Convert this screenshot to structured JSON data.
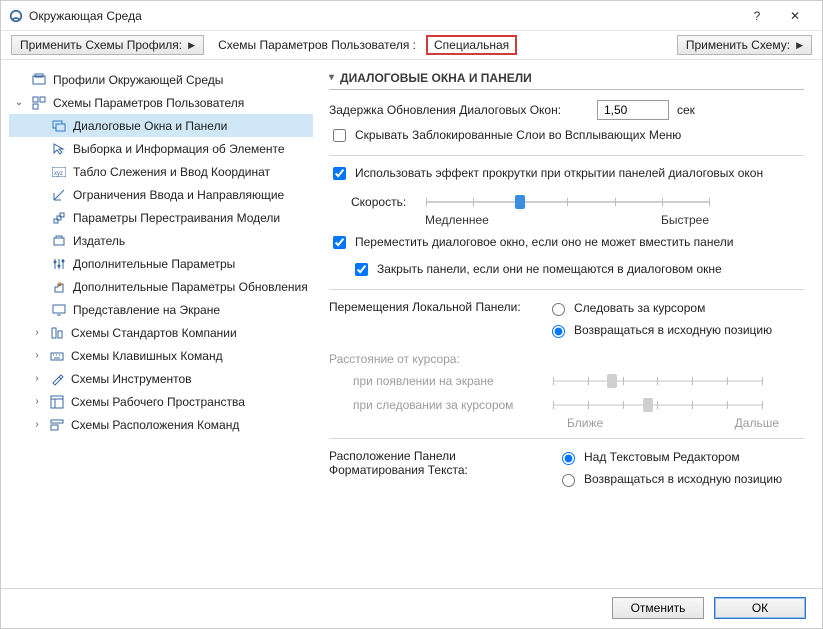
{
  "window": {
    "title": "Окружающая Среда",
    "help": "?",
    "close": "✕"
  },
  "toolbar": {
    "apply_profile": "Применить Схемы Профиля:",
    "scheme_label": "Схемы Параметров Пользователя :",
    "scheme_value": "Специальная",
    "apply_scheme": "Применить Схему:"
  },
  "tree": {
    "root": "Профили Окружающей Среды",
    "user_schemes": "Схемы Параметров Пользователя",
    "items": [
      "Диалоговые Окна и Панели",
      "Выборка и Информация об Элементе",
      "Табло Слежения и Ввод Координат",
      "Ограничения Ввода и Направляющие",
      "Параметры Перестраивания Модели",
      "Издатель",
      "Дополнительные Параметры",
      "Дополнительные Параметры Обновления",
      "Представление на Экране"
    ],
    "company": "Схемы Стандартов Компании",
    "keyboard": "Схемы Клавишных Команд",
    "tools": "Схемы Инструментов",
    "workspace": "Схемы Рабочего Пространства",
    "commands": "Схемы Расположения Команд"
  },
  "panel": {
    "header": "ДИАЛОГОВЫЕ ОКНА И ПАНЕЛИ",
    "delay_label": "Задержка Обновления Диалоговых Окон:",
    "delay_value": "1,50",
    "delay_unit": "сек",
    "hide_locked": "Скрывать Заблокированные Слои во Всплывающих Меню",
    "scroll_effect": "Использовать эффект прокрутки при открытии панелей диалоговых окон",
    "speed_label": "Скорость:",
    "slower": "Медленнее",
    "faster": "Быстрее",
    "move_dialog": "Переместить диалоговое окно, если оно не может вместить панели",
    "close_panels": "Закрыть панели, если они не помещаются в диалоговом окне",
    "local_panel_move": "Перемещения Локальной Панели:",
    "follow_cursor": "Следовать за курсором",
    "return_home": "Возвращаться в исходную позицию",
    "cursor_distance": "Расстояние от курсора:",
    "on_appear": "при появлении на экране",
    "on_follow": "при следовании за курсором",
    "closer": "Ближе",
    "farther": "Дальше",
    "text_panel_pos": "Расположение Панели Форматирования Текста:",
    "above_editor": "Над Текстовым Редактором",
    "return_home2": "Возвращаться в исходную позицию"
  },
  "footer": {
    "cancel": "Отменить",
    "ok": "ОК"
  }
}
